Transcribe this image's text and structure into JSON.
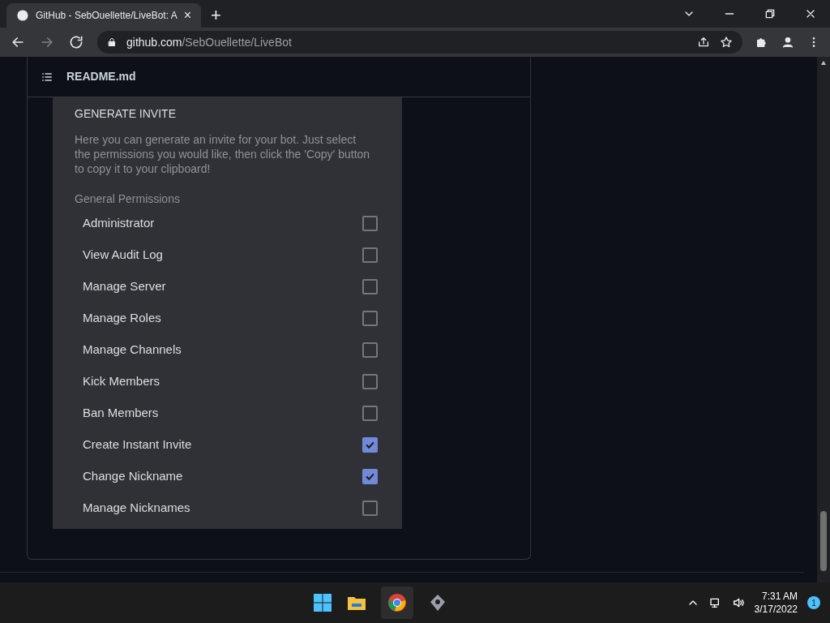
{
  "browser": {
    "tab_title": "GitHub - SebOuellette/LiveBot: A",
    "tab_close": "×",
    "new_tab": "+",
    "url_host": "github.com",
    "url_path": "/SebOuellette/LiveBot"
  },
  "readme": {
    "title": "README.md"
  },
  "invite": {
    "title": "GENERATE INVITE",
    "description": "Here you can generate an invite for your bot. Just select the permissions you would like, then click the 'Copy' button to copy it to your clipboard!",
    "section": "General Permissions",
    "permissions": [
      {
        "label": "Administrator",
        "checked": false
      },
      {
        "label": "View Audit Log",
        "checked": false
      },
      {
        "label": "Manage Server",
        "checked": false
      },
      {
        "label": "Manage Roles",
        "checked": false
      },
      {
        "label": "Manage Channels",
        "checked": false
      },
      {
        "label": "Kick Members",
        "checked": false
      },
      {
        "label": "Ban Members",
        "checked": false
      },
      {
        "label": "Create Instant Invite",
        "checked": true
      },
      {
        "label": "Change Nickname",
        "checked": true
      },
      {
        "label": "Manage Nicknames",
        "checked": false
      }
    ]
  },
  "taskbar": {
    "time": "7:31 AM",
    "date": "3/17/2022",
    "notifications": "1"
  }
}
